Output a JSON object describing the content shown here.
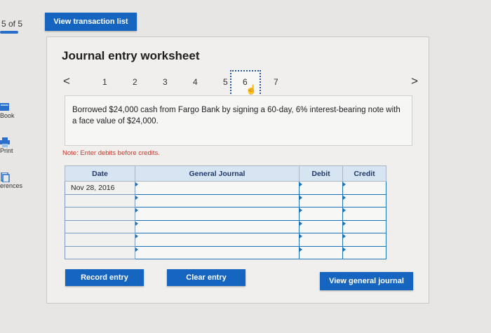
{
  "top": {
    "page_counter": "5 of 5",
    "transaction_list_button": "View transaction list"
  },
  "left_rail": {
    "items": [
      {
        "label": "Book",
        "icon": "book-icon"
      },
      {
        "label": "Print",
        "icon": "print-icon"
      },
      {
        "label": "erences",
        "icon": "references-icon"
      }
    ]
  },
  "worksheet": {
    "title": "Journal entry worksheet",
    "pager": {
      "prev": "<",
      "next": ">",
      "pages": [
        "1",
        "2",
        "3",
        "4",
        "5",
        "6",
        "7"
      ],
      "active": "6"
    },
    "description": "Borrowed $24,000 cash from Fargo Bank by signing a 60-day, 6% interest-bearing note with a face value of $24,000.",
    "note": "Note: Enter debits before credits.",
    "table": {
      "headers": [
        "Date",
        "General Journal",
        "Debit",
        "Credit"
      ],
      "rows": [
        [
          "Nov 28, 2016",
          "",
          "",
          ""
        ],
        [
          "",
          "",
          "",
          ""
        ],
        [
          "",
          "",
          "",
          ""
        ],
        [
          "",
          "",
          "",
          ""
        ],
        [
          "",
          "",
          "",
          ""
        ],
        [
          "",
          "",
          "",
          ""
        ]
      ]
    },
    "buttons": {
      "record": "Record entry",
      "clear": "Clear entry",
      "view_general_journal": "View general journal"
    }
  },
  "colors": {
    "accent": "#1565c0",
    "note": "#c0392b",
    "header_bg": "#d7e4f2"
  }
}
